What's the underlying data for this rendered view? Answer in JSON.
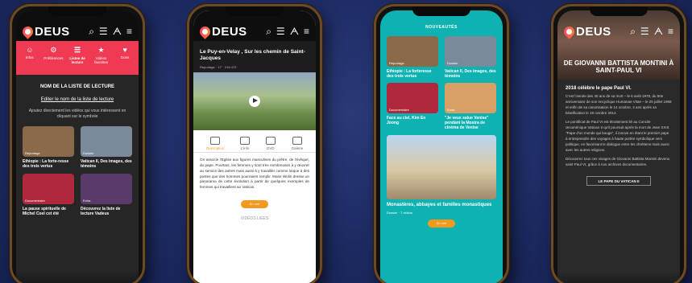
{
  "brand": "DEUS",
  "phone1": {
    "tabs": [
      {
        "label": "Infos"
      },
      {
        "label": "Préférences"
      },
      {
        "label": "Listes de lecture"
      },
      {
        "label": "Vidéos favorites"
      },
      {
        "label": "Dons"
      }
    ],
    "list_title": "NOM DE LA LISTE DE LECTURE",
    "edit_link": "Editer le nom de la liste de lecture",
    "hint": "Ajoutez directement les vidéos qui vous intéressent en cliquant sur le symbole",
    "cards": [
      {
        "title": "Ethiopie : La forte-resse des trois vertus",
        "tag": "Reportage",
        "color": "#8a6a4a"
      },
      {
        "title": "Vatican II, Des images, des témoins",
        "tag": "Dossier",
        "color": "#7a8a9a"
      },
      {
        "title": "La pause spirituelle de Michel Coel cet été",
        "tag": "Documentaire",
        "color": "#b0283c"
      },
      {
        "title": "Découvrez la liste de lecture Vadeus",
        "tag": "Extra",
        "color": "#5a3a6a"
      }
    ]
  },
  "phone2": {
    "title": "Le Puy-en-Velay , Sur les chemin de Saint-Jacques",
    "meta": "Reportage · 17' · 216 472",
    "tabs": [
      "Description",
      "L'info",
      "DVD",
      "Galerie"
    ],
    "body": "On associe l'Eglise aux figures masculines du prêtre, de l'évêque, du pape. Pourtant, les femmes y sont très nombreuses à y œuvrer au service des autres mais aussi à y travailler comme laïque à des postes que des hommes pourraient remplir. Marie Wolin dresse un panorama de cette évolution à partir de quelques exemples de femmes qui travaillent au Vatican.",
    "more_btn": "En voir",
    "footer": "VIDÉOS LIÉES"
  },
  "phone3": {
    "section": "NOUVEAUTÉS",
    "cards": [
      {
        "title": "Ethiopie : La forteresse des trois vertus",
        "tag": "Reportage",
        "color": "#8a6a4a"
      },
      {
        "title": "Vatican II, Des images, des témoins",
        "tag": "Dossier",
        "color": "#7a8a9a"
      },
      {
        "title": "Face au ciel, Kim En Joong",
        "tag": "Documentaire",
        "color": "#b0283c"
      },
      {
        "title": "\"Je veux salue Venise\" pendant la Mostra de cinéma de Venise",
        "tag": "Extra",
        "color": "#d9a066"
      }
    ],
    "feature": {
      "title": "Monastères, abbayes et familles monastiques",
      "tag": "Dossier · 7 vidéos"
    },
    "more_btn": "En voir"
  },
  "phone4": {
    "hero_title": "DE GIOVANNI BATTISTA MONTINI À SAINT-PAUL VI",
    "heading": "2018 célèbre le pape Paul VI.",
    "para1": "C'est l'année des 40 ans de sa mort – le 6 août 1978, du 50e anniversaire de son encyclique Humanae Vitae – le 25 juillet 1968 et enfin de sa canonisation le 14 octobre, 4 ans après sa béatification le 19 octobre 2014.",
    "para2": "Le pontificat de Paul VI est étroitement lié au Concile œcuménique Vatican II qu'il poursuit après la mort de Jean XXIII. \"Pape d'un monde qui bouge\", il innove en étant le premier pape à entreprendre des voyages à haute portée symbolique vers politique, en favorisant le dialogue entre les chrétiens mais aussi avec les autres religions.",
    "para3": "Découvrez tous ces visages de Giovanni Battista Montini devenu saint Paul VI, grâce à nos archives documentaires.",
    "button": "LE PAPE DU VATICAN II"
  }
}
